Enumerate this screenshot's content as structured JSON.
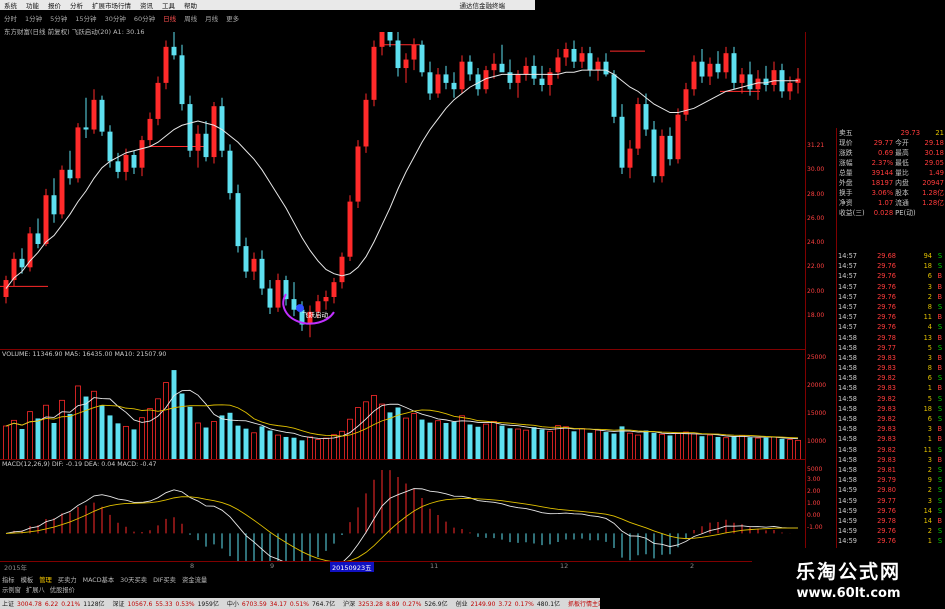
{
  "menubar": {
    "items": [
      "系统",
      "功能",
      "报价",
      "分析",
      "扩展市场行情",
      "资讯",
      "工具",
      "帮助"
    ],
    "title": "通达信金融终端"
  },
  "periods": {
    "items": [
      "分时",
      "1分钟",
      "5分钟",
      "15分钟",
      "30分钟",
      "60分钟",
      "日线",
      "周线",
      "月线",
      "更多"
    ],
    "active_index": 6
  },
  "main_indicator": "东方财富(日线 前复权) 飞跃启动(20) A1: 30.16",
  "annotation": "飞跃启动",
  "volume_line": "VOLUME: 11346.90  MA5: 16435.00  MA10: 21507.90",
  "macd_line": "MACD(12,26,9) DIF: -0.19  DEA: 0.04  MACD: -0.47",
  "axis": {
    "price": [
      "31.21",
      "30.00",
      "28.00",
      "26.00",
      "24.00",
      "22.00",
      "20.00",
      "18.00"
    ],
    "volume": [
      "25000",
      "20000",
      "15000",
      "10000",
      "5000"
    ],
    "macd": [
      "3.00",
      "2.00",
      "1.00",
      "0.00",
      "-1.00"
    ]
  },
  "quote": {
    "header": {
      "label": "卖五",
      "price": "29.73",
      "vol": "21"
    },
    "rows": [
      {
        "l1": "现价",
        "v1": "29.77",
        "l2": "今开",
        "v2": "29.18"
      },
      {
        "l1": "涨跌",
        "v1": "0.69",
        "l2": "最高",
        "v2": "30.18"
      },
      {
        "l1": "涨幅",
        "v1": "2.37%",
        "l2": "最低",
        "v2": "29.05"
      },
      {
        "l1": "总量",
        "v1": "39144",
        "l2": "量比",
        "v2": "1.49"
      },
      {
        "l1": "外盘",
        "v1": "18197",
        "l2": "内盘",
        "v2": "20947"
      },
      {
        "l1": "换手",
        "v1": "3.06%",
        "l2": "股本",
        "v2": "1.28亿"
      },
      {
        "l1": "净资",
        "v1": "1.07",
        "l2": "流通",
        "v2": "1.28亿"
      },
      {
        "l1": "收益(三)",
        "v1": "0.028",
        "l2": "PE(动)",
        "v2": ""
      }
    ]
  },
  "ticks": [
    {
      "t": "14:57",
      "p": "29.68",
      "v": "94",
      "d": "S"
    },
    {
      "t": "14:57",
      "p": "29.76",
      "v": "18",
      "d": "S"
    },
    {
      "t": "14:57",
      "p": "29.76",
      "v": "6",
      "d": "B"
    },
    {
      "t": "14:57",
      "p": "29.76",
      "v": "3",
      "d": "B"
    },
    {
      "t": "14:57",
      "p": "29.76",
      "v": "2",
      "d": "B"
    },
    {
      "t": "14:57",
      "p": "29.76",
      "v": "8",
      "d": "S"
    },
    {
      "t": "14:57",
      "p": "29.76",
      "v": "11",
      "d": "B"
    },
    {
      "t": "14:57",
      "p": "29.76",
      "v": "4",
      "d": "S"
    },
    {
      "t": "14:58",
      "p": "29.78",
      "v": "13",
      "d": "B"
    },
    {
      "t": "14:58",
      "p": "29.77",
      "v": "5",
      "d": "S"
    },
    {
      "t": "14:58",
      "p": "29.83",
      "v": "3",
      "d": "B"
    },
    {
      "t": "14:58",
      "p": "29.83",
      "v": "8",
      "d": "B"
    },
    {
      "t": "14:58",
      "p": "29.82",
      "v": "6",
      "d": "S"
    },
    {
      "t": "14:58",
      "p": "29.83",
      "v": "1",
      "d": "B"
    },
    {
      "t": "14:58",
      "p": "29.82",
      "v": "5",
      "d": "S"
    },
    {
      "t": "14:58",
      "p": "29.83",
      "v": "18",
      "d": "S"
    },
    {
      "t": "14:58",
      "p": "29.82",
      "v": "6",
      "d": "S"
    },
    {
      "t": "14:58",
      "p": "29.83",
      "v": "3",
      "d": "B"
    },
    {
      "t": "14:58",
      "p": "29.83",
      "v": "1",
      "d": "B"
    },
    {
      "t": "14:58",
      "p": "29.82",
      "v": "11",
      "d": "S"
    },
    {
      "t": "14:58",
      "p": "29.83",
      "v": "3",
      "d": "B"
    },
    {
      "t": "14:58",
      "p": "29.81",
      "v": "2",
      "d": "S"
    },
    {
      "t": "14:58",
      "p": "29.79",
      "v": "9",
      "d": "S"
    },
    {
      "t": "14:59",
      "p": "29.80",
      "v": "2",
      "d": "S"
    },
    {
      "t": "14:59",
      "p": "29.77",
      "v": "3",
      "d": "S"
    },
    {
      "t": "14:59",
      "p": "29.76",
      "v": "14",
      "d": "S"
    },
    {
      "t": "14:59",
      "p": "29.78",
      "v": "14",
      "d": "B"
    },
    {
      "t": "14:59",
      "p": "29.76",
      "v": "2",
      "d": "S"
    },
    {
      "t": "14:59",
      "p": "29.76",
      "v": "1",
      "d": "S"
    },
    {
      "t": "14:59",
      "p": "29.75",
      "v": "1",
      "d": "S"
    },
    {
      "t": "14:59",
      "p": "29.76",
      "v": "8",
      "d": "S"
    }
  ],
  "datebar": {
    "labels": [
      "2015年",
      "8",
      "9",
      "20150923五",
      "11",
      "12",
      "2"
    ]
  },
  "tabbar": {
    "items": [
      "指标",
      "模板",
      "管理",
      "买卖力",
      "MACD基本",
      "30天买卖",
      "DIF买卖",
      "资金流量"
    ],
    "active_index": 2
  },
  "subbar": [
    "示例窗",
    "扩展八",
    "优股报价"
  ],
  "statusbar": {
    "items": [
      {
        "label": "上证",
        "value": "3004.78",
        "chg": "6.22",
        "pct": "0.21%",
        "amt": "1128亿"
      },
      {
        "label": "深证",
        "value": "10567.6",
        "chg": "55.33",
        "pct": "0.53%",
        "amt": "1959亿"
      },
      {
        "label": "中小",
        "value": "6703.59",
        "chg": "34.17",
        "pct": "0.51%",
        "amt": "764.7亿"
      },
      {
        "label": "沪深",
        "value": "3253.28",
        "chg": "8.89",
        "pct": "0.27%",
        "amt": "526.9亿"
      },
      {
        "label": "创业",
        "value": "2149.90",
        "chg": "3.72",
        "pct": "0.17%",
        "amt": "480.1亿"
      }
    ],
    "right": "抓板行情主站"
  },
  "watermark": {
    "title": "乐淘公式网",
    "url": "www.60lt.com"
  },
  "colors": {
    "up": "#ff2a2a",
    "down": "#5ee0f0",
    "ma": "#e8e8e8",
    "dif": "#e8e8e8",
    "dea": "#e0c000",
    "annotation": "#c030ff"
  },
  "chart_data": {
    "type": "candlestick",
    "price_range": [
      17,
      32
    ],
    "candles": [
      [
        19.5,
        20.5,
        19.2,
        20.3
      ],
      [
        20.3,
        21.6,
        20.0,
        21.3
      ],
      [
        21.3,
        21.8,
        20.6,
        20.9
      ],
      [
        20.9,
        22.8,
        20.7,
        22.5
      ],
      [
        22.5,
        23.2,
        21.8,
        22.0
      ],
      [
        22.0,
        24.6,
        21.9,
        24.3
      ],
      [
        24.3,
        25.1,
        23.0,
        23.4
      ],
      [
        23.4,
        25.7,
        23.2,
        25.5
      ],
      [
        25.5,
        26.4,
        24.8,
        25.1
      ],
      [
        25.1,
        27.7,
        24.9,
        27.5
      ],
      [
        27.5,
        28.9,
        27.0,
        27.4
      ],
      [
        27.4,
        29.3,
        27.2,
        28.8
      ],
      [
        28.8,
        29.0,
        27.1,
        27.3
      ],
      [
        27.3,
        27.6,
        25.6,
        25.9
      ],
      [
        25.9,
        26.3,
        25.1,
        25.4
      ],
      [
        25.4,
        26.5,
        25.0,
        26.2
      ],
      [
        26.2,
        26.4,
        25.3,
        25.6
      ],
      [
        25.6,
        27.1,
        25.2,
        26.9
      ],
      [
        26.9,
        28.2,
        26.6,
        27.9
      ],
      [
        27.9,
        29.9,
        27.6,
        29.6
      ],
      [
        29.6,
        31.6,
        29.3,
        31.3
      ],
      [
        31.3,
        33.6,
        30.7,
        30.9
      ],
      [
        30.9,
        31.4,
        28.3,
        28.6
      ],
      [
        28.6,
        29.0,
        26.1,
        26.4
      ],
      [
        26.4,
        27.6,
        25.6,
        27.2
      ],
      [
        27.2,
        27.8,
        25.9,
        26.1
      ],
      [
        26.1,
        28.7,
        25.8,
        28.5
      ],
      [
        28.5,
        28.9,
        26.1,
        26.4
      ],
      [
        26.4,
        26.7,
        24.1,
        24.4
      ],
      [
        24.4,
        24.8,
        21.6,
        21.9
      ],
      [
        21.9,
        22.3,
        20.4,
        20.7
      ],
      [
        20.7,
        21.6,
        20.3,
        21.3
      ],
      [
        21.3,
        21.7,
        19.6,
        19.9
      ],
      [
        19.9,
        20.3,
        18.7,
        19.0
      ],
      [
        19.0,
        20.6,
        18.8,
        20.3
      ],
      [
        20.3,
        20.5,
        19.1,
        19.4
      ],
      [
        19.4,
        20.2,
        18.6,
        18.9
      ],
      [
        18.9,
        19.3,
        17.9,
        18.2
      ],
      [
        18.2,
        19.1,
        17.6,
        18.8
      ],
      [
        18.8,
        19.6,
        18.5,
        19.3
      ],
      [
        19.3,
        19.8,
        18.9,
        19.5
      ],
      [
        19.5,
        20.4,
        19.2,
        20.2
      ],
      [
        20.2,
        21.6,
        19.9,
        21.4
      ],
      [
        21.4,
        24.3,
        21.2,
        24.0
      ],
      [
        24.0,
        26.9,
        23.7,
        26.6
      ],
      [
        26.6,
        29.1,
        26.3,
        28.8
      ],
      [
        28.8,
        31.6,
        28.5,
        31.3
      ],
      [
        31.3,
        33.1,
        30.9,
        32.8
      ],
      [
        32.8,
        33.6,
        31.3,
        31.6
      ],
      [
        31.6,
        32.1,
        29.9,
        30.3
      ],
      [
        30.3,
        31.0,
        29.6,
        30.7
      ],
      [
        30.7,
        31.7,
        30.2,
        31.4
      ],
      [
        31.4,
        31.6,
        29.9,
        30.1
      ],
      [
        30.1,
        30.6,
        28.8,
        29.1
      ],
      [
        29.1,
        30.3,
        28.9,
        30.0
      ],
      [
        30.0,
        30.4,
        29.3,
        29.6
      ],
      [
        29.6,
        30.1,
        28.9,
        29.3
      ],
      [
        29.3,
        30.9,
        29.1,
        30.6
      ],
      [
        30.6,
        30.9,
        29.7,
        30.0
      ],
      [
        30.0,
        30.3,
        29.0,
        29.3
      ],
      [
        29.3,
        30.4,
        29.1,
        30.2
      ],
      [
        30.2,
        31.0,
        29.8,
        30.5
      ],
      [
        30.5,
        31.4,
        30.2,
        30.1
      ],
      [
        30.1,
        30.7,
        29.3,
        29.6
      ],
      [
        29.6,
        30.2,
        28.9,
        30.0
      ],
      [
        30.0,
        30.8,
        29.7,
        30.4
      ],
      [
        30.4,
        30.9,
        29.5,
        29.8
      ],
      [
        29.8,
        30.4,
        29.2,
        29.5
      ],
      [
        29.5,
        30.3,
        29.0,
        30.1
      ],
      [
        30.1,
        31.2,
        29.8,
        30.8
      ],
      [
        30.8,
        31.5,
        30.4,
        31.2
      ],
      [
        31.2,
        31.6,
        30.3,
        30.6
      ],
      [
        30.6,
        31.3,
        30.3,
        31.0
      ],
      [
        31.0,
        31.3,
        29.9,
        30.2
      ],
      [
        30.2,
        30.8,
        29.7,
        30.6
      ],
      [
        30.6,
        31.0,
        29.9,
        30.0
      ],
      [
        30.0,
        30.2,
        27.7,
        28.0
      ],
      [
        28.0,
        28.6,
        25.3,
        25.6
      ],
      [
        25.6,
        26.9,
        25.1,
        26.5
      ],
      [
        26.5,
        28.9,
        26.2,
        28.6
      ],
      [
        28.6,
        29.1,
        27.1,
        27.4
      ],
      [
        27.4,
        27.8,
        24.9,
        25.2
      ],
      [
        25.2,
        27.4,
        24.9,
        27.1
      ],
      [
        27.1,
        27.5,
        25.7,
        26.0
      ],
      [
        26.0,
        28.4,
        25.8,
        28.1
      ],
      [
        28.1,
        29.6,
        27.8,
        29.3
      ],
      [
        29.3,
        30.9,
        29.0,
        30.6
      ],
      [
        30.6,
        31.2,
        29.6,
        29.9
      ],
      [
        29.9,
        30.8,
        29.5,
        30.5
      ],
      [
        30.5,
        31.1,
        29.8,
        30.1
      ],
      [
        30.1,
        31.3,
        29.8,
        31.0
      ],
      [
        31.0,
        31.3,
        29.3,
        29.6
      ],
      [
        29.6,
        30.3,
        29.1,
        30.0
      ],
      [
        30.0,
        30.6,
        29.0,
        29.3
      ],
      [
        29.3,
        30.2,
        28.8,
        29.8
      ],
      [
        29.8,
        30.4,
        29.2,
        29.5
      ],
      [
        29.5,
        30.6,
        29.2,
        30.2
      ],
      [
        30.2,
        30.5,
        28.9,
        29.2
      ],
      [
        29.2,
        29.9,
        28.8,
        29.6
      ],
      [
        29.6,
        30.3,
        29.1,
        29.8
      ]
    ],
    "ma": [
      19.9,
      20.4,
      20.7,
      21.2,
      21.6,
      22.1,
      22.4,
      22.9,
      23.4,
      24.0,
      24.5,
      25.1,
      25.6,
      25.9,
      26.1,
      26.3,
      26.4,
      26.5,
      26.6,
      26.8,
      27.1,
      27.4,
      27.6,
      27.7,
      27.8,
      27.7,
      27.6,
      27.4,
      27.1,
      26.8,
      26.4,
      26.0,
      25.5,
      24.9,
      24.3,
      23.7,
      23.0,
      22.3,
      21.7,
      21.2,
      20.8,
      20.6,
      20.5,
      20.6,
      20.9,
      21.4,
      22.1,
      22.9,
      23.7,
      24.6,
      25.4,
      26.1,
      26.8,
      27.4,
      27.9,
      28.4,
      28.8,
      29.1,
      29.4,
      29.6,
      29.8,
      29.9,
      30.0,
      30.0,
      30.0,
      30.0,
      30.0,
      30.0,
      30.0,
      30.0,
      30.1,
      30.1,
      30.2,
      30.2,
      30.2,
      30.2,
      30.0,
      29.7,
      29.4,
      29.2,
      28.9,
      28.6,
      28.4,
      28.2,
      28.2,
      28.3,
      28.4,
      28.6,
      28.8,
      29.0,
      29.2,
      29.3,
      29.4,
      29.5,
      29.6,
      29.6,
      29.7,
      29.7,
      29.7,
      29.7
    ],
    "volume": [
      9000,
      10500,
      8200,
      12800,
      11000,
      14500,
      9800,
      15800,
      12200,
      19600,
      16800,
      18200,
      14500,
      11800,
      9700,
      8900,
      8100,
      11200,
      13600,
      16200,
      20500,
      23800,
      17600,
      14100,
      9800,
      8600,
      10200,
      11800,
      12500,
      9100,
      8300,
      7200,
      8900,
      7800,
      6600,
      6100,
      5900,
      5200,
      6100,
      5400,
      5800,
      6700,
      7600,
      10800,
      13900,
      15400,
      17100,
      14800,
      12600,
      13900,
      11100,
      12300,
      10700,
      9900,
      10400,
      9800,
      10100,
      11700,
      9400,
      8800,
      9500,
      10200,
      9100,
      8400,
      8200,
      7900,
      8700,
      8100,
      7600,
      9100,
      8800,
      7600,
      8300,
      7200,
      7900,
      7400,
      7000,
      8900,
      7100,
      6600,
      7800,
      7200,
      6800,
      6500,
      7000,
      7400,
      6900,
      6300,
      6600,
      6100,
      5900,
      6200,
      6500,
      6000,
      5800,
      5900,
      6100,
      5600,
      5400,
      5200
    ],
    "volume_range": [
      0,
      27000
    ],
    "macd_range": [
      -1.4,
      3.2
    ]
  }
}
